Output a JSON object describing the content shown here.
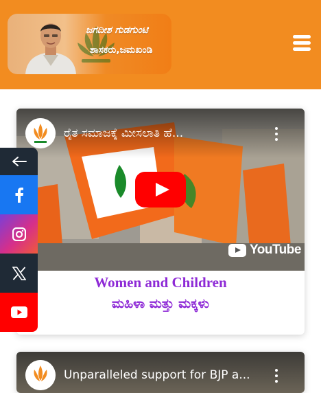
{
  "header": {
    "brand_name": "ಜಗದೀಶ ಗುಡಗುಂಟಿ",
    "brand_title": "ಶಾಸಕರು,ಜಮಖಂಡಿ",
    "menu_icon": "hamburger-menu-icon",
    "background_color": "#f28c20"
  },
  "videos": [
    {
      "title": "ರೈತ ಸಮಾಜಕ್ಕೆ ಮೀಸಲಾತಿ ಹೆ...",
      "channel_avatar": "bjp-lotus-icon",
      "player_logo": "YouTube",
      "caption_en": "Women and Children",
      "caption_kn": "ಮಹಿಳಾ ಮತ್ತು ಮಕ್ಕಳು"
    },
    {
      "title": "Unparalleled support for BJP a...",
      "channel_avatar": "bjp-lotus-icon"
    }
  ],
  "social": [
    {
      "name": "toggle",
      "icon": "arrow-left-icon"
    },
    {
      "name": "facebook",
      "icon": "facebook-icon",
      "color": "#1877f2"
    },
    {
      "name": "instagram",
      "icon": "instagram-icon",
      "color": "#d62f8a"
    },
    {
      "name": "x",
      "icon": "x-twitter-icon",
      "color": "#1f2a36"
    },
    {
      "name": "youtube",
      "icon": "youtube-icon",
      "color": "#ff0000"
    }
  ],
  "colors": {
    "caption": "#8e2ad6",
    "play_button": "#ff0000"
  }
}
